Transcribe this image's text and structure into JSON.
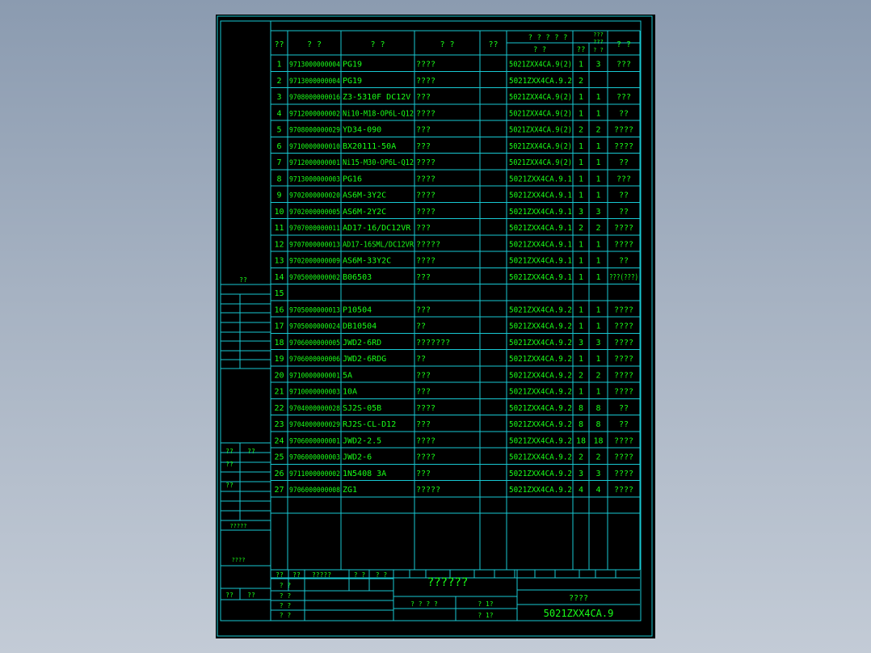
{
  "header": {
    "seq": "??",
    "code": "?  ?",
    "name": "?    ?",
    "spec": "?    ?",
    "qty": "??",
    "group": "? ? ? ? ?",
    "sub_a": "?      ?",
    "sub_b": "??",
    "sub_c": "? ?",
    "total_a": "???",
    "total_b": "???",
    "total_c": "? ?",
    "remark": "?  ?"
  },
  "rows": [
    {
      "no": "1",
      "code": "9713000000004",
      "model": "PG19",
      "desc": "????",
      "drawing": "5021ZXX4CA.9(2)",
      "n1": "1",
      "n2": "3",
      "note": "???"
    },
    {
      "no": "2",
      "code": "9713000000004",
      "model": "PG19",
      "desc": "????",
      "drawing": "5021ZXX4CA.9.2",
      "n1": "2",
      "n2": "",
      "note": ""
    },
    {
      "no": "3",
      "code": "9708000000016",
      "model": "Z3-5310F DC12V",
      "desc": "???",
      "drawing": "5021ZXX4CA.9(2)",
      "n1": "1",
      "n2": "1",
      "note": "???"
    },
    {
      "no": "4",
      "code": "9712000000002",
      "model": "Ni10-M18-OP6L-Q12",
      "desc": "????",
      "drawing": "5021ZXX4CA.9(2)",
      "n1": "1",
      "n2": "1",
      "note": "??"
    },
    {
      "no": "5",
      "code": "9708000000029",
      "model": "YD34-090",
      "desc": "???",
      "drawing": "5021ZXX4CA.9(2)",
      "n1": "2",
      "n2": "2",
      "note": "????"
    },
    {
      "no": "6",
      "code": "9710000000010",
      "model": "BX20111-50A",
      "desc": "???",
      "drawing": "5021ZXX4CA.9(2)",
      "n1": "1",
      "n2": "1",
      "note": "????"
    },
    {
      "no": "7",
      "code": "9712000000001",
      "model": "Ni15-M30-OP6L-Q12",
      "desc": "????",
      "drawing": "5021ZXX4CA.9(2)",
      "n1": "1",
      "n2": "1",
      "note": "??"
    },
    {
      "no": "8",
      "code": "9713000000003",
      "model": "PG16",
      "desc": "????",
      "drawing": "5021ZXX4CA.9.1",
      "n1": "1",
      "n2": "1",
      "note": "???"
    },
    {
      "no": "9",
      "code": "9702000000020",
      "model": "AS6M-3Y2C",
      "desc": "????",
      "drawing": "5021ZXX4CA.9.1",
      "n1": "1",
      "n2": "1",
      "note": "??"
    },
    {
      "no": "10",
      "code": "9702000000005",
      "model": "AS6M-2Y2C",
      "desc": "????",
      "drawing": "5021ZXX4CA.9.1",
      "n1": "3",
      "n2": "3",
      "note": "??"
    },
    {
      "no": "11",
      "code": "9707000000011",
      "model": "AD17-16/DC12VR",
      "desc": "???",
      "drawing": "5021ZXX4CA.9.1",
      "n1": "2",
      "n2": "2",
      "note": "????"
    },
    {
      "no": "12",
      "code": "9707000000013",
      "model": "AD17-16SML/DC12VR",
      "desc": "?????",
      "drawing": "5021ZXX4CA.9.1",
      "n1": "1",
      "n2": "1",
      "note": "????"
    },
    {
      "no": "13",
      "code": "9702000000009",
      "model": "AS6M-33Y2C",
      "desc": "????",
      "drawing": "5021ZXX4CA.9.1",
      "n1": "1",
      "n2": "1",
      "note": "??"
    },
    {
      "no": "14",
      "code": "9705000000002",
      "model": "B06503",
      "desc": "???",
      "drawing": "5021ZXX4CA.9.1",
      "n1": "1",
      "n2": "1",
      "note": "???(???)"
    },
    {
      "no": "15",
      "code": "",
      "model": "",
      "desc": "",
      "drawing": "",
      "n1": "",
      "n2": "",
      "note": ""
    },
    {
      "no": "16",
      "code": "9705000000013",
      "model": "P10504",
      "desc": "???",
      "drawing": "5021ZXX4CA.9.2",
      "n1": "1",
      "n2": "1",
      "note": "????"
    },
    {
      "no": "17",
      "code": "9705000000024",
      "model": "DB10504",
      "desc": "??",
      "drawing": "5021ZXX4CA.9.2",
      "n1": "1",
      "n2": "1",
      "note": "????"
    },
    {
      "no": "18",
      "code": "9706000000005",
      "model": "JWD2-6RD",
      "desc": "???????",
      "drawing": "5021ZXX4CA.9.2",
      "n1": "3",
      "n2": "3",
      "note": "????"
    },
    {
      "no": "19",
      "code": "9706000000006",
      "model": "JWD2-6RDG",
      "desc": "??",
      "drawing": "5021ZXX4CA.9.2",
      "n1": "1",
      "n2": "1",
      "note": "????"
    },
    {
      "no": "20",
      "code": "9710000000001",
      "model": "5A",
      "desc": "???",
      "drawing": "5021ZXX4CA.9.2",
      "n1": "2",
      "n2": "2",
      "note": "????"
    },
    {
      "no": "21",
      "code": "9710000000003",
      "model": "10A",
      "desc": "???",
      "drawing": "5021ZXX4CA.9.2",
      "n1": "1",
      "n2": "1",
      "note": "????"
    },
    {
      "no": "22",
      "code": "9704000000028",
      "model": "SJ2S-05B",
      "desc": "????",
      "drawing": "5021ZXX4CA.9.2",
      "n1": "8",
      "n2": "8",
      "note": "??"
    },
    {
      "no": "23",
      "code": "9704000000029",
      "model": "RJ2S-CL-D12",
      "desc": "???",
      "drawing": "5021ZXX4CA.9.2",
      "n1": "8",
      "n2": "8",
      "note": "??"
    },
    {
      "no": "24",
      "code": "9706000000001",
      "model": "JWD2-2.5",
      "desc": "????",
      "drawing": "5021ZXX4CA.9.2",
      "n1": "18",
      "n2": "18",
      "note": "????"
    },
    {
      "no": "25",
      "code": "9706000000003",
      "model": "JWD2-6",
      "desc": "????",
      "drawing": "5021ZXX4CA.9.2",
      "n1": "2",
      "n2": "2",
      "note": "????"
    },
    {
      "no": "26",
      "code": "9711000000002",
      "model": "1N5408 3A",
      "desc": "???",
      "drawing": "5021ZXX4CA.9.2",
      "n1": "3",
      "n2": "3",
      "note": "????"
    },
    {
      "no": "27",
      "code": "9706000000008",
      "model": "ZG1",
      "desc": "?????",
      "drawing": "5021ZXX4CA.9.2",
      "n1": "4",
      "n2": "4",
      "note": "????"
    }
  ],
  "left_panel": {
    "label_top": "??",
    "label_a1": "??",
    "label_a2": "??",
    "label_b": "??",
    "label_c": "??",
    "label_d": "?????",
    "label_e": "????",
    "label_f1": "??",
    "label_f2": "??"
  },
  "title_block": {
    "sign_1": "??",
    "sign_2": "??",
    "sign_3": "?????",
    "sign_4": "? ?",
    "sign_5": "? ?",
    "row_a": "? ?",
    "row_b": "? ?",
    "row_c": "? ?",
    "row_d": "? ?",
    "main_title": "??????",
    "stage": "? ? ? ?",
    "sheet_a": "?  1?",
    "sheet_b": "?  1?",
    "doc_type": "????",
    "drawing_no": "5021ZXX4CA.9"
  },
  "colors": {
    "line": "#18c8d2",
    "text": "#19ff19",
    "background": "#000000"
  }
}
